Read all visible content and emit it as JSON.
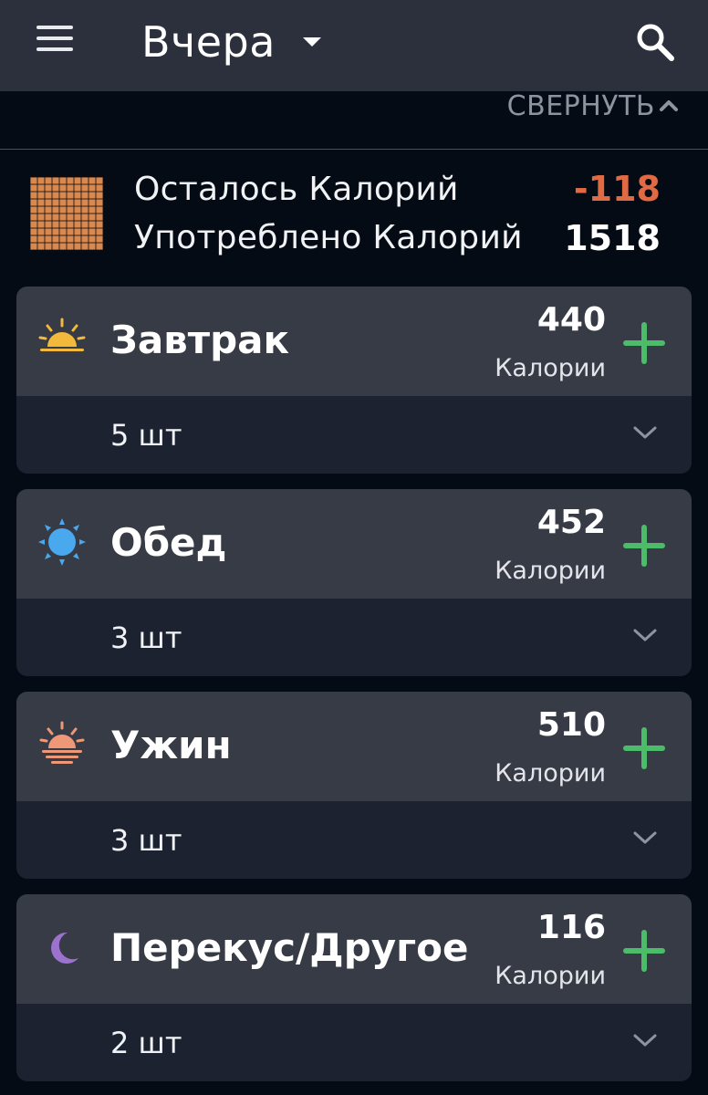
{
  "header": {
    "title": "Вчера"
  },
  "collapse": {
    "label": "СВЕРНУТЬ"
  },
  "summary": {
    "remaining_label": "Осталось Калорий",
    "remaining_value": "-118",
    "consumed_label": "Употреблено Калорий",
    "consumed_value": "1518"
  },
  "meals": [
    {
      "name": "Завтрак",
      "calories": "440",
      "calories_label": "Калории",
      "count": "5 шт",
      "icon": "sunrise-icon"
    },
    {
      "name": "Обед",
      "calories": "452",
      "calories_label": "Калории",
      "count": "3 шт",
      "icon": "sun-icon"
    },
    {
      "name": "Ужин",
      "calories": "510",
      "calories_label": "Калории",
      "count": "3 шт",
      "icon": "sunset-icon"
    },
    {
      "name": "Перекус/Другое",
      "calories": "116",
      "calories_label": "Калории",
      "count": "2 шт",
      "icon": "moon-icon"
    }
  ],
  "colors": {
    "header_bg": "#2b303c",
    "page_bg": "#050b14",
    "card_head": "#373b46",
    "card_foot": "#1c2230",
    "accent_green": "#4cbb6a",
    "negative_orange": "#e06a43",
    "grid_orange": "#d9894e"
  }
}
